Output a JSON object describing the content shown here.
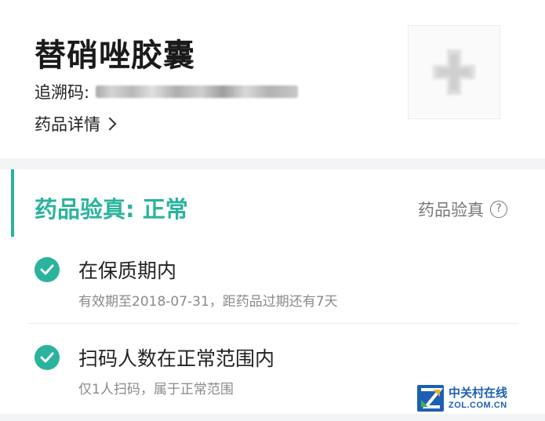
{
  "drug": {
    "name": "替硝唑胶囊",
    "trace_code_label": "追溯码:",
    "details_link": "药品详情"
  },
  "verification": {
    "title": "药品验真: 正常",
    "help_link": "药品验真",
    "help_icon_glyph": "?",
    "accent_color": "#2bb39d",
    "items": [
      {
        "title": "在保质期内",
        "subtitle": "有效期至2018-07-31，距药品过期还有7天",
        "icon": "check-circle-icon"
      },
      {
        "title": "扫码人数在正常范围内",
        "subtitle": "仅1人扫码，属于正常范围",
        "icon": "check-circle-icon"
      }
    ]
  },
  "watermark": {
    "cn": "中关村在线",
    "en": "ZOL.COM.CN"
  }
}
